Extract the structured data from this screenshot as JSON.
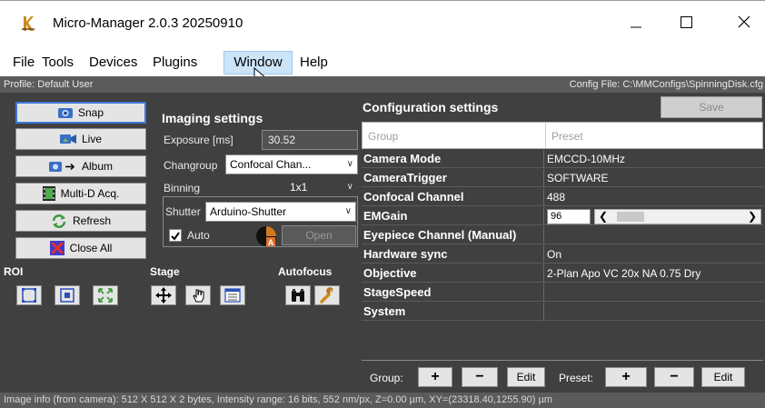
{
  "window": {
    "title": "Micro-Manager 2.0.3 20250910"
  },
  "menu": {
    "items": [
      "File",
      "Tools",
      "Devices",
      "Plugins",
      "Window",
      "Help"
    ],
    "active": "Window"
  },
  "profile_bar": {
    "profile": "Profile: Default User",
    "config_file": "Config File: C:\\MMConfigs\\SpinningDisk.cfg"
  },
  "left_buttons": {
    "snap": "Snap",
    "live": "Live",
    "album": "Album",
    "multid": "Multi-D Acq.",
    "refresh": "Refresh",
    "close_all": "Close All"
  },
  "imaging": {
    "title": "Imaging settings",
    "exposure_label": "Exposure [ms]",
    "exposure_value": "30.52",
    "changroup_label": "Changroup",
    "changroup_value": "Confocal Chan...",
    "binning_label": "Binning",
    "binning_value": "1x1",
    "shutter_label": "Shutter",
    "shutter_value": "Arduino-Shutter",
    "auto_label": "Auto",
    "open_label": "Open"
  },
  "sections": {
    "roi": "ROI",
    "stage": "Stage",
    "autofocus": "Autofocus"
  },
  "config": {
    "title": "Configuration settings",
    "save_label": "Save",
    "col_group": "Group",
    "col_preset": "Preset",
    "rows": [
      {
        "group": "Camera Mode",
        "preset": "EMCCD-10MHz"
      },
      {
        "group": "CameraTrigger",
        "preset": "SOFTWARE"
      },
      {
        "group": "Confocal Channel",
        "preset": "488"
      },
      {
        "group": "EMGain",
        "preset": "96"
      },
      {
        "group": "Eyepiece Channel (Manual)",
        "preset": ""
      },
      {
        "group": "Hardware sync",
        "preset": "On"
      },
      {
        "group": "Objective",
        "preset": "2-Plan Apo VC 20x NA 0.75 Dry"
      },
      {
        "group": "StageSpeed",
        "preset": ""
      },
      {
        "group": "System",
        "preset": ""
      }
    ],
    "group_label": "Group:",
    "preset_label": "Preset:",
    "plus": "+",
    "minus": "−",
    "edit": "Edit"
  },
  "status": {
    "text": "Image info (from camera): 512 X 512 X 2 bytes, Intensity range: 16 bits, 552 nm/px, Z=0.00 µm, XY=(23318.40,1255.90) µm"
  },
  "colors": {
    "panel_bg": "#404040",
    "bar_bg": "#5b5b5b",
    "menu_highlight": "#cce4f7",
    "default_button_border": "#3c78d8"
  }
}
